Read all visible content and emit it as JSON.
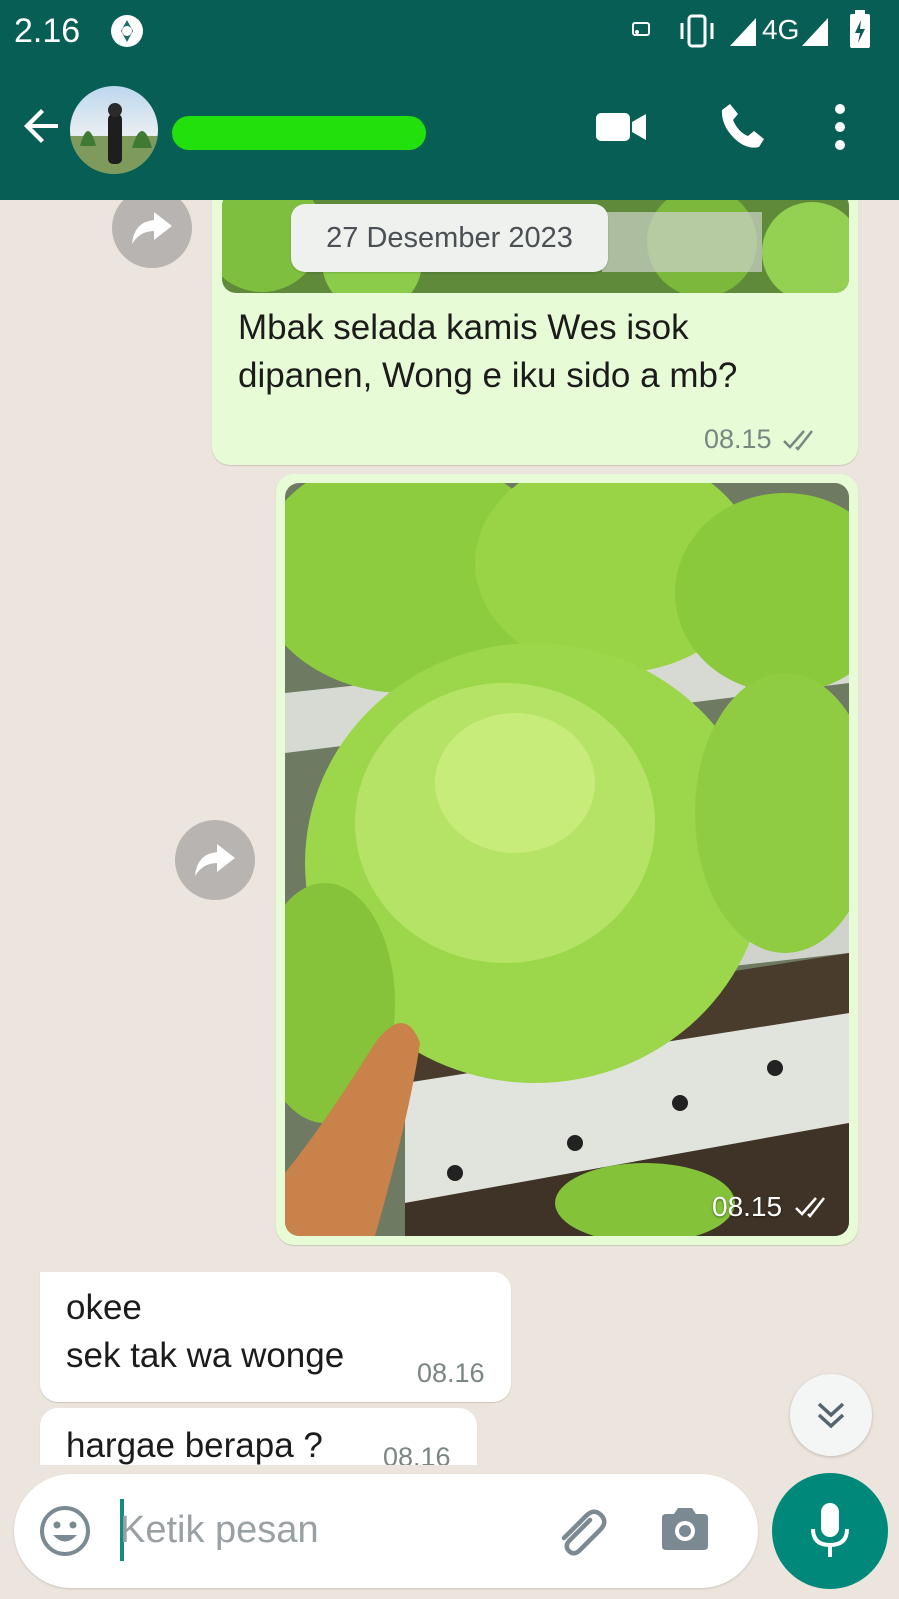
{
  "status_bar": {
    "time": "2.16",
    "network": "4G"
  },
  "header": {
    "back_icon": "arrow-left-icon",
    "contact_name": "",
    "video_icon": "videocam-icon",
    "call_icon": "phone-icon",
    "menu_icon": "more-vert-icon"
  },
  "chat": {
    "date_chip": "27 Desember 2023",
    "messages": [
      {
        "direction": "out",
        "text": "Mbak selada kamis Wes isok\ndipanen, Wong e iku sido a mb?",
        "time": "08.15",
        "status": "read"
      },
      {
        "direction": "out",
        "type": "image",
        "time": "08.15",
        "status": "read"
      },
      {
        "direction": "in",
        "text": "okee\nsek tak wa wonge",
        "time": "08.16"
      },
      {
        "direction": "in",
        "text": "hargae berapa ?",
        "time": "08.16"
      }
    ]
  },
  "input": {
    "placeholder": "Ketik pesan",
    "value": ""
  },
  "colors": {
    "header": "#075e54",
    "outgoing": "#e7fcd6",
    "incoming": "#ffffff",
    "accent": "#00897b",
    "background": "#ece5dd"
  }
}
